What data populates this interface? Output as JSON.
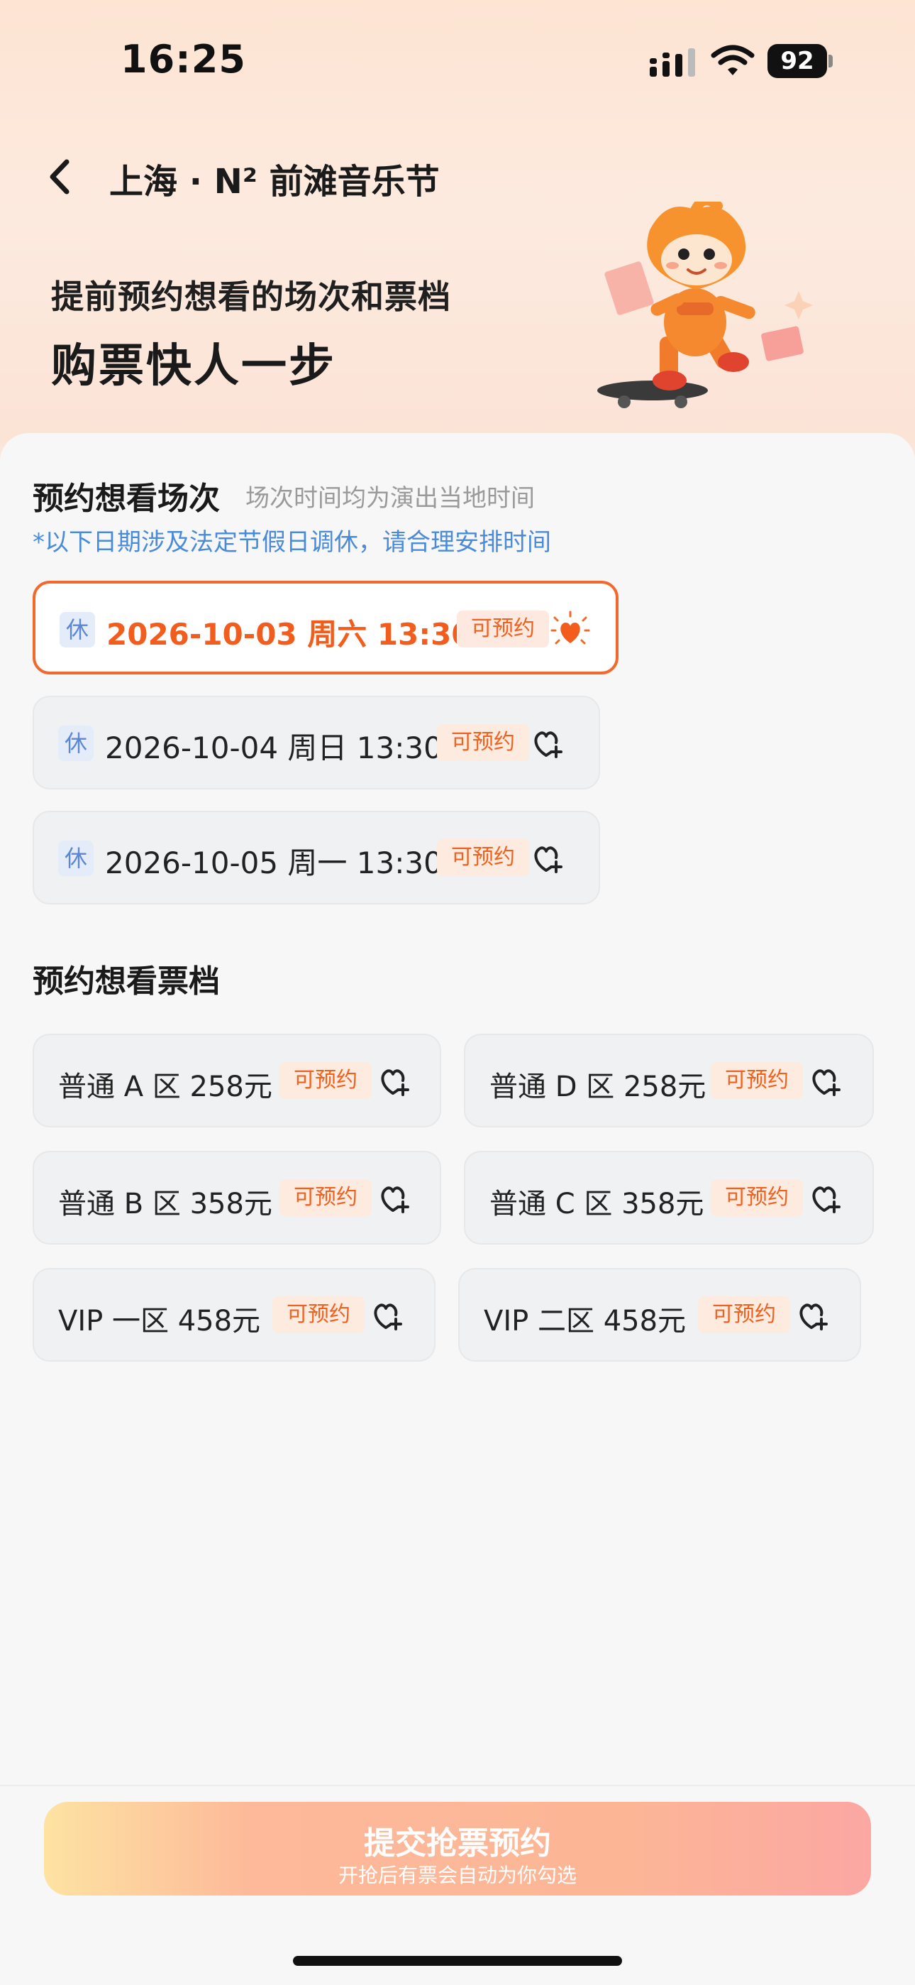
{
  "status_bar": {
    "time": "16:25",
    "battery": "92"
  },
  "nav": {
    "title": "上海 · N² 前滩音乐节"
  },
  "hero": {
    "line1": "提前预约想看的场次和票档",
    "line2": "购票快人一步"
  },
  "sessions_section": {
    "title": "预约想看场次",
    "subtitle": "场次时间均为演出当地时间",
    "notice": "*以下日期涉及法定节假日调休，请合理安排时间",
    "items": [
      {
        "badge": "休",
        "label": "2026-10-03  周六 13:30",
        "tag": "可预约",
        "selected": true
      },
      {
        "badge": "休",
        "label": "2026-10-04 周日 13:30",
        "tag": "可预约",
        "selected": false
      },
      {
        "badge": "休",
        "label": "2026-10-05 周一 13:30",
        "tag": "可预约",
        "selected": false
      }
    ]
  },
  "tiers_section": {
    "title": "预约想看票档",
    "items": [
      {
        "label": "普通 A 区 258元",
        "tag": "可预约"
      },
      {
        "label": "普通 D 区 258元",
        "tag": "可预约"
      },
      {
        "label": "普通 B 区 358元",
        "tag": "可预约"
      },
      {
        "label": "普通 C 区 358元",
        "tag": "可预约"
      },
      {
        "label": "VIP 一区 458元",
        "tag": "可预约"
      },
      {
        "label": "VIP 二区 458元",
        "tag": "可预约"
      }
    ]
  },
  "submit": {
    "label": "提交抢票预约",
    "sublabel": "开抢后有票会自动为你勾选"
  },
  "colors": {
    "accent": "#f25c1c",
    "notice_blue": "#4a8bd9",
    "tag_bg": "#fdebe0"
  },
  "icons": {
    "back": "chevron-left-icon",
    "heart_add": "heart-plus-icon",
    "heart_selected": "heart-filled-icon"
  }
}
